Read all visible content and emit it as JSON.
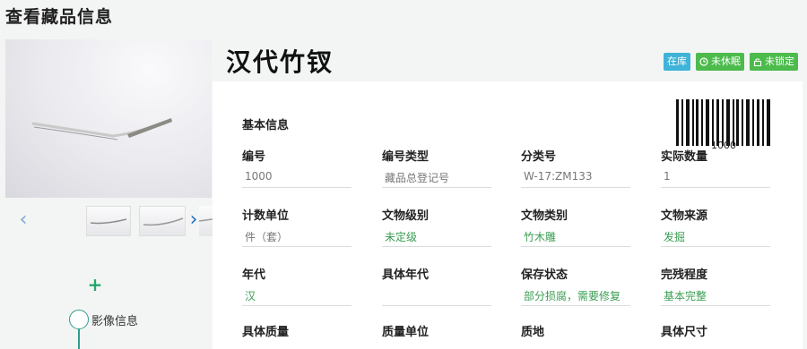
{
  "page_title": "查看藏品信息",
  "item": {
    "name": "汉代竹钗",
    "badges": [
      {
        "label": "在库",
        "color": "#3fb3d8",
        "icon": ""
      },
      {
        "label": "未休眠",
        "color": "#4cbb4c",
        "icon": "clock-icon"
      },
      {
        "label": "未锁定",
        "color": "#4cbb4c",
        "icon": "lock-icon"
      }
    ]
  },
  "gallery": {
    "prev_icon": "chevron-left-icon",
    "next_icon": "chevron-right-icon",
    "add_icon": "plus-icon",
    "media_label": "影像信息"
  },
  "basic_info": {
    "section_title": "基本信息",
    "barcode_number": "1000",
    "fields": {
      "number": {
        "label": "编号",
        "value": "1000"
      },
      "number_type": {
        "label": "编号类型",
        "value": "藏品总登记号"
      },
      "category_no": {
        "label": "分类号",
        "value": "W-17:ZM133"
      },
      "actual_qty": {
        "label": "实际数量",
        "value": "1"
      },
      "count_unit": {
        "label": "计数单位",
        "value": "件（套）"
      },
      "relic_level": {
        "label": "文物级别",
        "value": "未定级"
      },
      "relic_category": {
        "label": "文物类别",
        "value": "竹木雕"
      },
      "relic_source": {
        "label": "文物来源",
        "value": "发掘"
      },
      "era": {
        "label": "年代",
        "value": "汉"
      },
      "specific_era": {
        "label": "具体年代",
        "value": ""
      },
      "preservation": {
        "label": "保存状态",
        "value": "部分损腐，需要修复"
      },
      "completeness": {
        "label": "完残程度",
        "value": "基本完整"
      },
      "specific_mass": {
        "label": "具体质量",
        "value": ""
      },
      "mass_unit": {
        "label": "质量单位",
        "value": ""
      },
      "texture": {
        "label": "质地",
        "value": ""
      },
      "specific_size": {
        "label": "具体尺寸",
        "value": ""
      }
    }
  }
}
